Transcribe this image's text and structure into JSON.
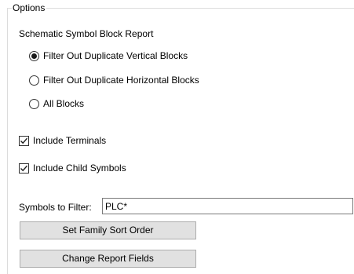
{
  "options": {
    "group_title": "Options",
    "section_label": "Schematic Symbol Block Report",
    "report_mode": {
      "selected": "Filter Out Duplicate Vertical Blocks",
      "choices": [
        {
          "label": "Filter Out Duplicate Vertical Blocks",
          "checked": true
        },
        {
          "label": "Filter Out Duplicate Horizontal Blocks",
          "checked": false
        },
        {
          "label": "All Blocks",
          "checked": false
        }
      ]
    },
    "include_terminals": {
      "label": "Include Terminals",
      "checked": true
    },
    "include_child_symbols": {
      "label": "Include Child Symbols",
      "checked": true
    },
    "symbols_filter": {
      "label": "Symbols to Filter:",
      "value": "PLC*"
    },
    "buttons": {
      "set_family_sort_order": "Set Family Sort Order",
      "change_report_fields": "Change Report Fields"
    }
  }
}
